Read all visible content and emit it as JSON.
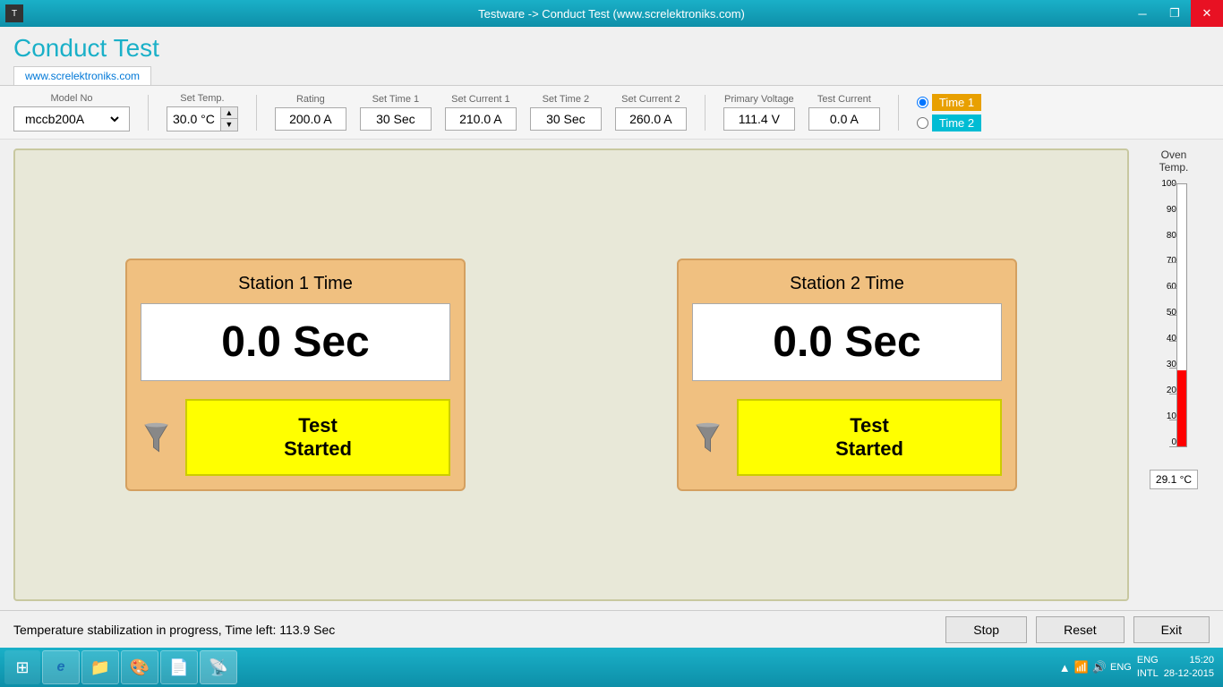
{
  "titlebar": {
    "title": "Testware -> Conduct Test (www.screlektroniks.com)",
    "minimize": "─",
    "restore": "❐",
    "close": "✕"
  },
  "page": {
    "title": "Conduct Test",
    "tab": "www.screlektroniks.com"
  },
  "settings": {
    "model_no_label": "Model No",
    "model_no_value": "mccb200A",
    "set_temp_label": "Set Temp.",
    "set_temp_value": "30.0 °C",
    "rating_label": "Rating",
    "rating_value": "200.0 A",
    "set_time1_label": "Set Time 1",
    "set_time1_value": "30 Sec",
    "set_current1_label": "Set Current 1",
    "set_current1_value": "210.0 A",
    "set_time2_label": "Set Time 2",
    "set_time2_value": "30 Sec",
    "set_current2_label": "Set Current 2",
    "set_current2_value": "260.0 A",
    "primary_voltage_label": "Primary Voltage",
    "primary_voltage_value": "111.4 V",
    "test_current_label": "Test Current",
    "test_current_value": "0.0 A",
    "time1_label": "Time 1",
    "time2_label": "Time 2"
  },
  "station1": {
    "title": "Station 1 Time",
    "time_value": "0.0 Sec",
    "status": "Test\nStarted"
  },
  "station2": {
    "title": "Station 2 Time",
    "time_value": "0.0 Sec",
    "status": "Test\nStarted"
  },
  "oven": {
    "title": "Oven\nTemp.",
    "max": 100,
    "min": 0,
    "fill_percent": 29,
    "value": "29.1 °C",
    "labels": [
      "100",
      "90",
      "80",
      "70",
      "60",
      "50",
      "40",
      "30",
      "20",
      "10",
      "0"
    ]
  },
  "statusbar": {
    "message": "Temperature stabilization in progress, Time left: 113.9 Sec",
    "stop_label": "Stop",
    "reset_label": "Reset",
    "exit_label": "Exit"
  },
  "taskbar": {
    "start_icon": "⊞",
    "btn1_icon": "e",
    "btn2_icon": "📁",
    "btn3_icon": "🎨",
    "btn4_icon": "📄",
    "btn5_icon": "📡",
    "lang": "ENG\nINTL",
    "time": "15:20",
    "date": "28-12-2015"
  }
}
